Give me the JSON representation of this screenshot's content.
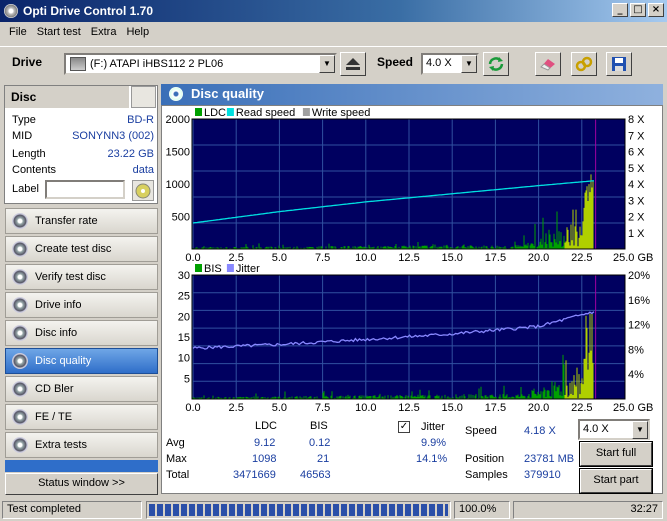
{
  "app": {
    "title": "Opti Drive Control 1.70"
  },
  "menu": [
    "File",
    "Start test",
    "Extra",
    "Help"
  ],
  "toolbar": {
    "drive_label": "Drive",
    "drive_value": "(F:)  ATAPI iHBS112   2 PL06",
    "speed_label": "Speed",
    "speed_value": "4.0 X"
  },
  "disc": {
    "header": "Disc",
    "fields": [
      {
        "k": "Type",
        "v": "BD-R"
      },
      {
        "k": "MID",
        "v": "SONYNN3 (002)"
      },
      {
        "k": "Length",
        "v": "23.22 GB"
      },
      {
        "k": "Contents",
        "v": "data"
      }
    ],
    "label_key": "Label",
    "label_value": ""
  },
  "nav": [
    "Transfer rate",
    "Create test disc",
    "Verify test disc",
    "Drive info",
    "Disc info",
    "Disc quality",
    "CD Bler",
    "FE / TE",
    "Extra tests"
  ],
  "nav_active": "Disc quality",
  "status_window": "Status window >>",
  "main": {
    "title": "Disc quality"
  },
  "colors": {
    "ldc": "#00a000",
    "read": "#00e0e0",
    "write": "#a0a0a0",
    "bis": "#00a000",
    "jitter": "#8888ff",
    "plot_bg": "#000060",
    "grid": "#3050a0"
  },
  "chart_data": [
    {
      "type": "area",
      "legend": [
        "LDC",
        "Read speed",
        "Write speed"
      ],
      "x_ticks": [
        "0.0",
        "2.5",
        "5.0",
        "7.5",
        "10.0",
        "12.5",
        "15.0",
        "17.5",
        "20.0",
        "22.5",
        "25.0 GB"
      ],
      "y_left_ticks": [
        "2000",
        "1500",
        "1000",
        "500"
      ],
      "y_right_ticks": [
        "8 X",
        "7 X",
        "6 X",
        "5 X",
        "4 X",
        "3 X",
        "2 X",
        "1 X"
      ],
      "xlim": [
        0,
        25
      ],
      "ylim": [
        0,
        2000
      ],
      "y2lim": [
        0,
        8
      ],
      "read_speed": {
        "x": [
          0,
          5,
          10,
          15,
          20,
          23.2
        ],
        "y": [
          1.6,
          2.3,
          2.9,
          3.4,
          3.9,
          4.2
        ]
      }
    },
    {
      "type": "area",
      "legend": [
        "BIS",
        "Jitter"
      ],
      "x_ticks": [
        "0.0",
        "2.5",
        "5.0",
        "7.5",
        "10.0",
        "12.5",
        "15.0",
        "17.5",
        "20.0",
        "22.5",
        "25.0 GB"
      ],
      "y_left_ticks": [
        "30",
        "25",
        "20",
        "15",
        "10",
        "5"
      ],
      "y_right_ticks": [
        "20%",
        "16%",
        "12%",
        "8%",
        "4%"
      ],
      "xlim": [
        0,
        25
      ],
      "ylim": [
        0,
        30
      ],
      "y2lim": [
        0,
        20
      ],
      "jitter": {
        "x": [
          0,
          5,
          10,
          15,
          20,
          23.2
        ],
        "y": [
          8.2,
          8.8,
          9.6,
          10.5,
          11.7,
          14.1
        ]
      }
    }
  ],
  "stats": {
    "col_ldc": "LDC",
    "col_bis": "BIS",
    "rows": [
      {
        "label": "Avg",
        "ldc": "9.12",
        "bis": "0.12",
        "jitter": "9.9%"
      },
      {
        "label": "Max",
        "ldc": "1098",
        "bis": "21",
        "jitter": "14.1%"
      },
      {
        "label": "Total",
        "ldc": "3471669",
        "bis": "46563"
      }
    ],
    "jitter_label": "Jitter",
    "speed_label": "Speed",
    "speed_value": "4.18 X",
    "position_label": "Position",
    "position_value": "23781 MB",
    "samples_label": "Samples",
    "samples_value": "379910",
    "speed_select": "4.0 X",
    "start_full": "Start full",
    "start_part": "Start part"
  },
  "status": {
    "text": "Test completed",
    "progress": "100.0%",
    "progress_value": 1.0,
    "time": "32:27"
  }
}
